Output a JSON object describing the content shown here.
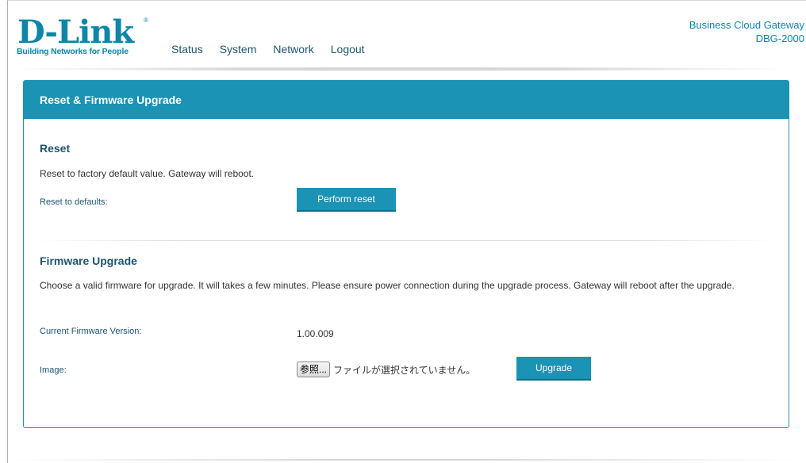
{
  "header": {
    "logo": {
      "brand": "D-Link",
      "registered_mark": "®",
      "tagline": "Building Networks for People"
    },
    "nav": [
      "Status",
      "System",
      "Network",
      "Logout"
    ],
    "product_line": "Business Cloud Gateway",
    "model": "DBG-2000"
  },
  "panel": {
    "title": "Reset & Firmware Upgrade",
    "reset": {
      "title": "Reset",
      "description": "Reset to factory default value. Gateway will reboot.",
      "label": "Reset to defaults:",
      "button": "Perform reset"
    },
    "firmware": {
      "title": "Firmware Upgrade",
      "description": "Choose a valid firmware for upgrade. It will takes a few minutes. Please ensure power connection during the upgrade process. Gateway will reboot after the upgrade.",
      "current_version_label": "Current Firmware Version:",
      "current_version": "1.00.009",
      "image_label": "Image:",
      "browse_button": "参照...",
      "no_file_text": "ファイルが選択されていません。",
      "upgrade_button": "Upgrade"
    }
  },
  "colors": {
    "accent": "#1a93b4",
    "brand": "#0d86a8",
    "label": "#1d5570"
  }
}
